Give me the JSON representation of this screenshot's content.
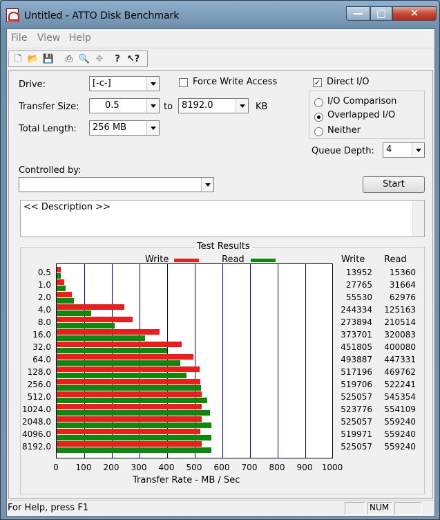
{
  "window": {
    "title": "Untitled - ATTO Disk Benchmark",
    "min": "—",
    "max": "□",
    "close": "✕"
  },
  "menu": [
    "File",
    "View",
    "Help"
  ],
  "toolbar": [
    "new-icon",
    "open-icon",
    "save-icon",
    "print-icon",
    "print-preview-icon",
    "move-icon",
    "help-icon",
    "context-help-icon"
  ],
  "form": {
    "drive_label": "Drive:",
    "drive_value": "[-c-]",
    "force_write_label": "Force Write Access",
    "force_write_checked": false,
    "direct_io_label": "Direct I/O",
    "direct_io_checked": true,
    "transfer_label": "Transfer Size:",
    "transfer_from": "0.5",
    "to_label": "to",
    "transfer_to": "8192.0",
    "kb_label": "KB",
    "total_label": "Total Length:",
    "total_value": "256 MB",
    "radio_io_comparison": "I/O Comparison",
    "radio_overlapped": "Overlapped I/O",
    "radio_neither": "Neither",
    "selected_radio": "Overlapped I/O",
    "queue_label": "Queue Depth:",
    "queue_value": "4",
    "controlled_label": "Controlled by:",
    "controlled_value": "",
    "start_label": "Start",
    "description": "<< Description >>"
  },
  "results_title": "Test Results",
  "legend": {
    "write": "Write",
    "read": "Read"
  },
  "columns": {
    "write": "Write",
    "read": "Read"
  },
  "colors": {
    "write": "#ee1c1c",
    "read": "#0a8a0a",
    "grid": "#0000a0"
  },
  "chart_data": {
    "type": "bar",
    "title": "Test Results",
    "xlabel": "Transfer Rate - MB / Sec",
    "xlim": [
      0,
      1000
    ],
    "xticks": [
      "0",
      "100",
      "200",
      "300",
      "400",
      "500",
      "600",
      "700",
      "800",
      "900",
      "1000"
    ],
    "categories": [
      "0.5",
      "1.0",
      "2.0",
      "4.0",
      "8.0",
      "16.0",
      "32.0",
      "64.0",
      "128.0",
      "256.0",
      "512.0",
      "1024.0",
      "2048.0",
      "4096.0",
      "8192.0"
    ],
    "series": [
      {
        "name": "Write",
        "values": [
          13952,
          27765,
          55530,
          244334,
          273894,
          373701,
          451805,
          493887,
          517196,
          519706,
          525057,
          523776,
          525057,
          519971,
          525057
        ],
        "labels": [
          "13952",
          "27765",
          "55530",
          "244334",
          "273894",
          "373701",
          "451805",
          "493887",
          "517196",
          "519706",
          "525057",
          "523776",
          "525057",
          "519971",
          "525057"
        ]
      },
      {
        "name": "Read",
        "values": [
          15360,
          31664,
          62976,
          125163,
          210514,
          320083,
          400080,
          447331,
          469762,
          522241,
          545354,
          554109,
          559240,
          559240,
          559240
        ],
        "labels": [
          "15360",
          "31664",
          "62976",
          "125163",
          "210514",
          "320083",
          "400080",
          "447331",
          "469762",
          "522241",
          "545354",
          "554109",
          "559240",
          "559240",
          "559240"
        ]
      }
    ]
  },
  "status": {
    "help": "For Help, press F1",
    "num": "NUM"
  }
}
